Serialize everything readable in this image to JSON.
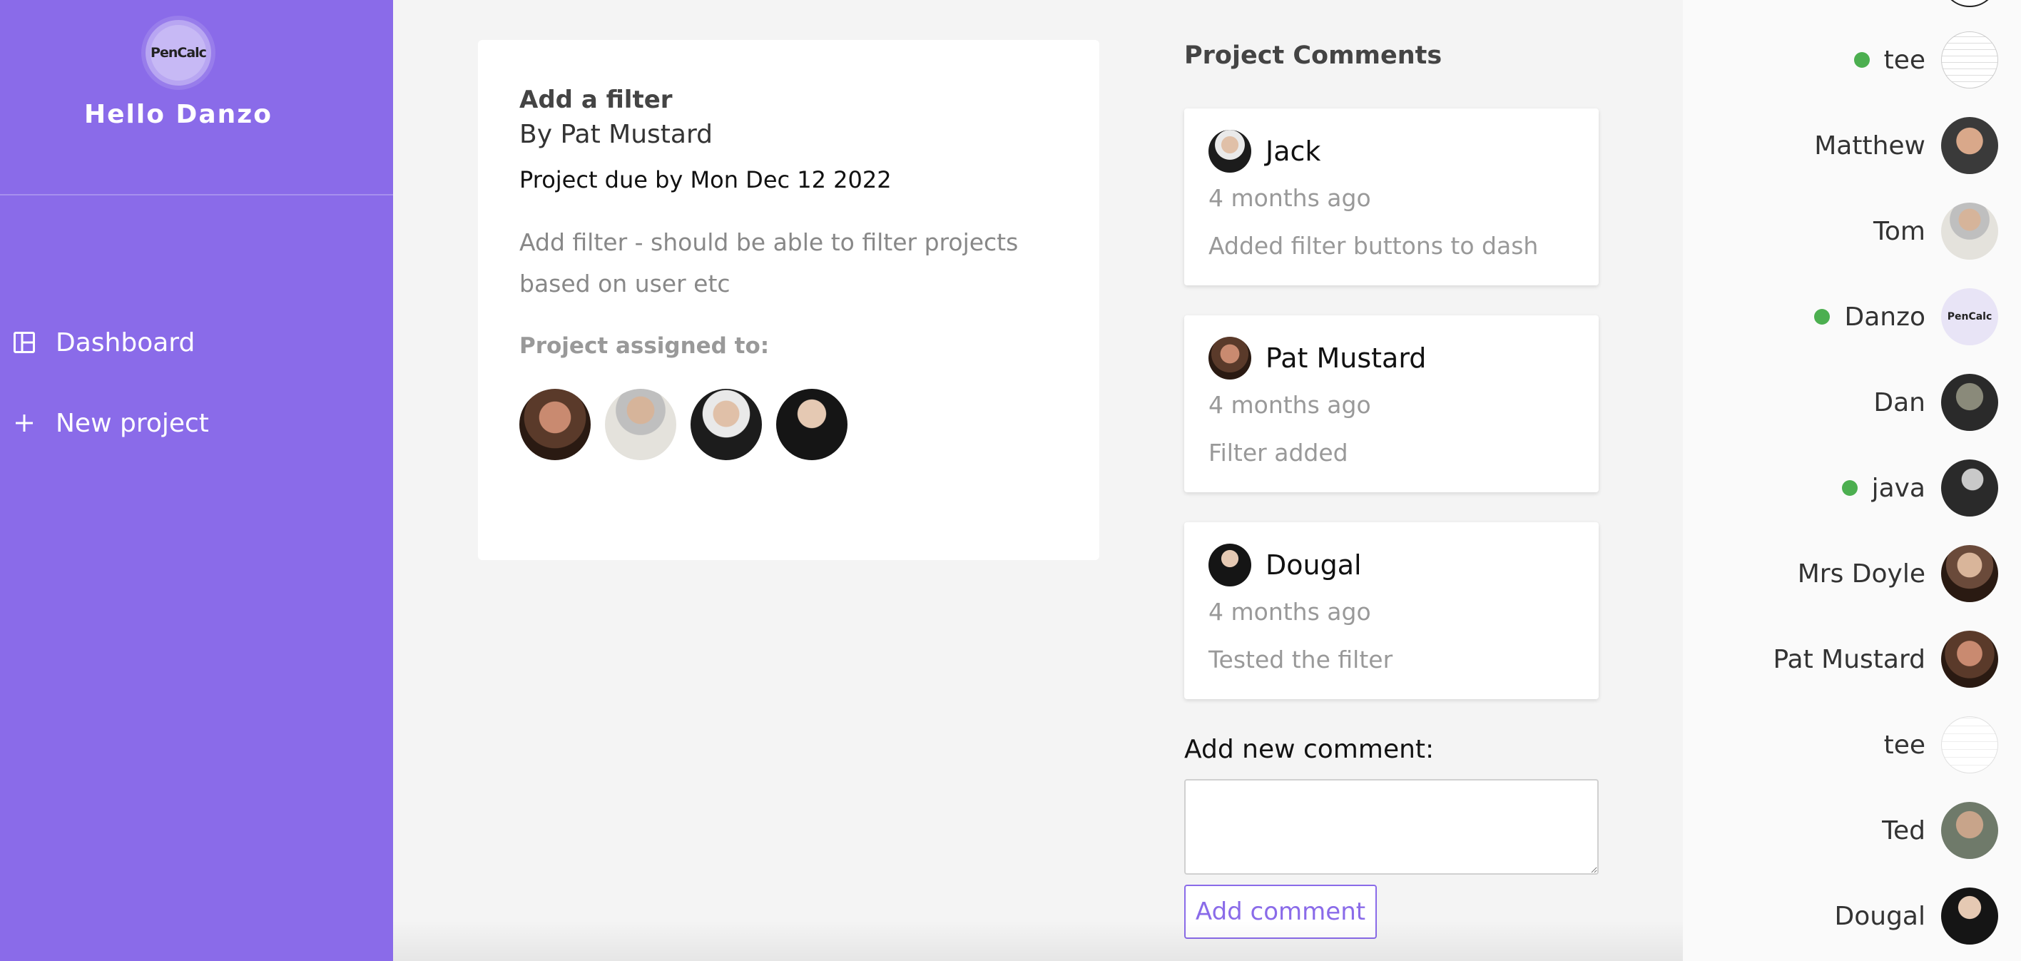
{
  "sidebar": {
    "logo_text": "PenCalc",
    "greeting": "Hello Danzo",
    "nav": [
      {
        "label": "Dashboard",
        "icon": "dashboard-icon"
      },
      {
        "label": "New project",
        "icon": "plus-icon"
      }
    ]
  },
  "project": {
    "title": "Add a filter",
    "author": "By Pat Mustard",
    "due": "Project due by Mon Dec 12 2022",
    "description": "Add filter - should be able to filter projects based on user etc",
    "assigned_label": "Project assigned to:",
    "assignees": [
      "Pat Mustard",
      "Tom",
      "Jack",
      "Dougal"
    ]
  },
  "comments": {
    "title": "Project Comments",
    "items": [
      {
        "author": "Jack",
        "time": "4 months ago",
        "text": "Added filter buttons to dash"
      },
      {
        "author": "Pat Mustard",
        "time": "4 months ago",
        "text": "Filter added"
      },
      {
        "author": "Dougal",
        "time": "4 months ago",
        "text": "Tested the filter"
      }
    ],
    "new_label": "Add new comment:",
    "button": "Add comment"
  },
  "users": [
    {
      "name": "tee",
      "online": true
    },
    {
      "name": "Matthew",
      "online": false
    },
    {
      "name": "Tom",
      "online": false
    },
    {
      "name": "Danzo",
      "online": true,
      "avatar_text": "PenCalc"
    },
    {
      "name": "Dan",
      "online": false
    },
    {
      "name": "java",
      "online": true
    },
    {
      "name": "Mrs Doyle",
      "online": false
    },
    {
      "name": "Pat Mustard",
      "online": false
    },
    {
      "name": "tee",
      "online": false
    },
    {
      "name": "Ted",
      "online": false
    },
    {
      "name": "Dougal",
      "online": false
    }
  ],
  "colors": {
    "accent": "#8a6be9",
    "online": "#4caf50"
  }
}
